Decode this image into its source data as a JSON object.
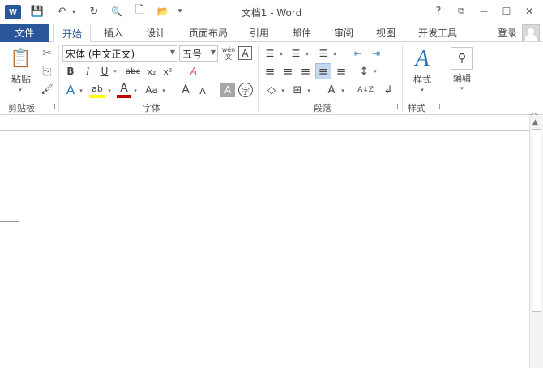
{
  "app": {
    "logo_letter": "W",
    "title": "文档1 - Word",
    "accent": "#2b579a"
  },
  "window": {
    "help": "?",
    "restore_ribbon": "⧉",
    "minimize": "—",
    "maximize": "☐",
    "close": "✕"
  },
  "quick_access": {
    "save": "💾",
    "undo": "↶",
    "redo": "↻",
    "print_preview": "🔍",
    "new": "🗋",
    "open": "📂",
    "customize": "▾"
  },
  "tabs": [
    {
      "label": "文件"
    },
    {
      "label": "开始"
    },
    {
      "label": "插入"
    },
    {
      "label": "设计"
    },
    {
      "label": "页面布局"
    },
    {
      "label": "引用"
    },
    {
      "label": "邮件"
    },
    {
      "label": "审阅"
    },
    {
      "label": "视图"
    },
    {
      "label": "开发工具"
    }
  ],
  "signin": "登录",
  "clipboard": {
    "label": "剪贴板",
    "paste": "粘贴",
    "cut": "✂",
    "copy": "⎘",
    "format_painter": "🖌"
  },
  "font": {
    "label": "字体",
    "font_name": "宋体 (中文正文)",
    "font_size": "五号",
    "phonetic": "wén\n文",
    "border_char": "A",
    "bold": "B",
    "italic": "I",
    "underline": "U",
    "strike": "abc",
    "subscript": "x₂",
    "superscript": "x²",
    "clear_format": "A",
    "text_effects": "A",
    "highlight": "ab",
    "font_color": "A",
    "change_case": "Aa",
    "grow": "A",
    "shrink": "A",
    "char_shading": "A",
    "enclose": "字"
  },
  "paragraph": {
    "label": "段落",
    "bullets": "☰",
    "numbering": "☰",
    "multilevel": "☰",
    "decrease_indent": "⇤",
    "increase_indent": "⇥",
    "align_left": "≡",
    "center": "≡",
    "align_right": "≡",
    "justify": "≡",
    "distributed": "≡",
    "line_spacing": "↕",
    "shading": "◇",
    "borders": "⊞",
    "chinese_layout": "A",
    "sort": "A↓Z",
    "show_marks": "↲"
  },
  "styles": {
    "label": "样式",
    "button": "样式"
  },
  "editing": {
    "button": "编辑"
  }
}
